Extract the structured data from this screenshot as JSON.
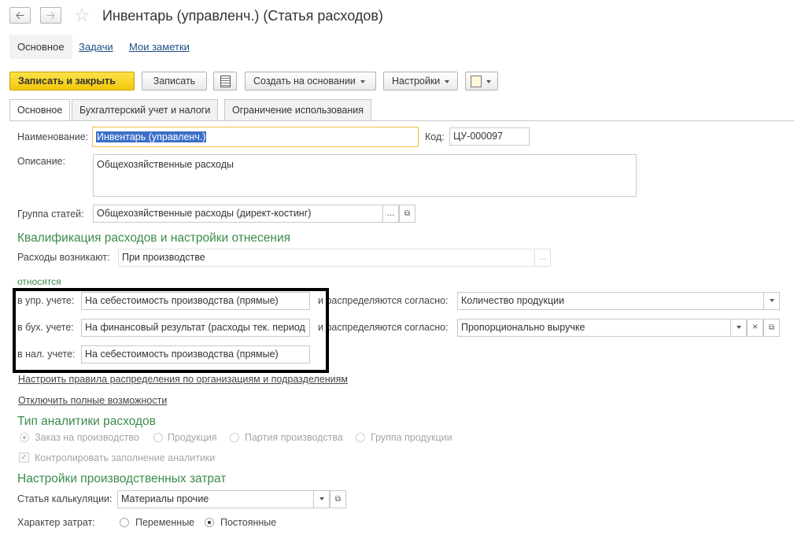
{
  "window": {
    "title": "Инвентарь (управленч.) (Статья расходов)",
    "back_icon": "arrow-left-icon",
    "forward_icon": "arrow-right-icon",
    "star_icon": "star-icon"
  },
  "section_tabs": [
    {
      "label": "Основное"
    },
    {
      "label": "Задачи"
    },
    {
      "label": "Мои заметки"
    }
  ],
  "toolbar": {
    "save_close": "Записать и закрыть",
    "save": "Записать",
    "create_based": "Создать на основании",
    "settings": "Настройки"
  },
  "tabs": [
    {
      "label": "Основное"
    },
    {
      "label": "Бухгалтерский учет и налоги"
    },
    {
      "label": "Ограничение использования"
    }
  ],
  "form": {
    "name_label": "Наименование:",
    "name_value": "Инвентарь (управленч.)",
    "code_label": "Код:",
    "code_value": "ЦУ-000097",
    "desc_label": "Описание:",
    "desc_value": "Общехозяйственные расходы",
    "group_label": "Группа статей:",
    "group_value": "Общехозяйственные расходы (директ-костинг)"
  },
  "qualification": {
    "heading": "Квалификация расходов и настройки отнесения",
    "arise_label": "Расходы возникают:",
    "arise_value": "При производстве",
    "related_label": "относятся",
    "rows": [
      {
        "label": "в упр. учете:",
        "value": "На себестоимость производства (прямые)",
        "dist_label": "и распределяются согласно:",
        "dist_value": "Количество продукции"
      },
      {
        "label": "в бух. учете:",
        "value": "На финансовый результат (расходы тек. период",
        "dist_label": "и распределяются согласно:",
        "dist_value": "Пропорционально выручке"
      },
      {
        "label": "в нал. учете:",
        "value": "На себестоимость производства (прямые)"
      }
    ],
    "link_rules": "Настроить правила распределения по организациям и подразделениям",
    "link_disable": "Отключить полные возможности"
  },
  "analytics": {
    "heading": "Тип аналитики расходов",
    "options": [
      "Заказ на производство",
      "Продукция",
      "Партия производства",
      "Группа продукции"
    ],
    "selected": "Заказ на производство",
    "check_label": "Контролировать заполнение аналитики",
    "checked": true
  },
  "production": {
    "heading": "Настройки производственных затрат",
    "calc_label": "Статья калькуляции:",
    "calc_value": "Материалы прочие",
    "nature_label": "Характер затрат:",
    "nature_options": [
      "Переменные",
      "Постоянные"
    ],
    "nature_selected": "Постоянные"
  }
}
